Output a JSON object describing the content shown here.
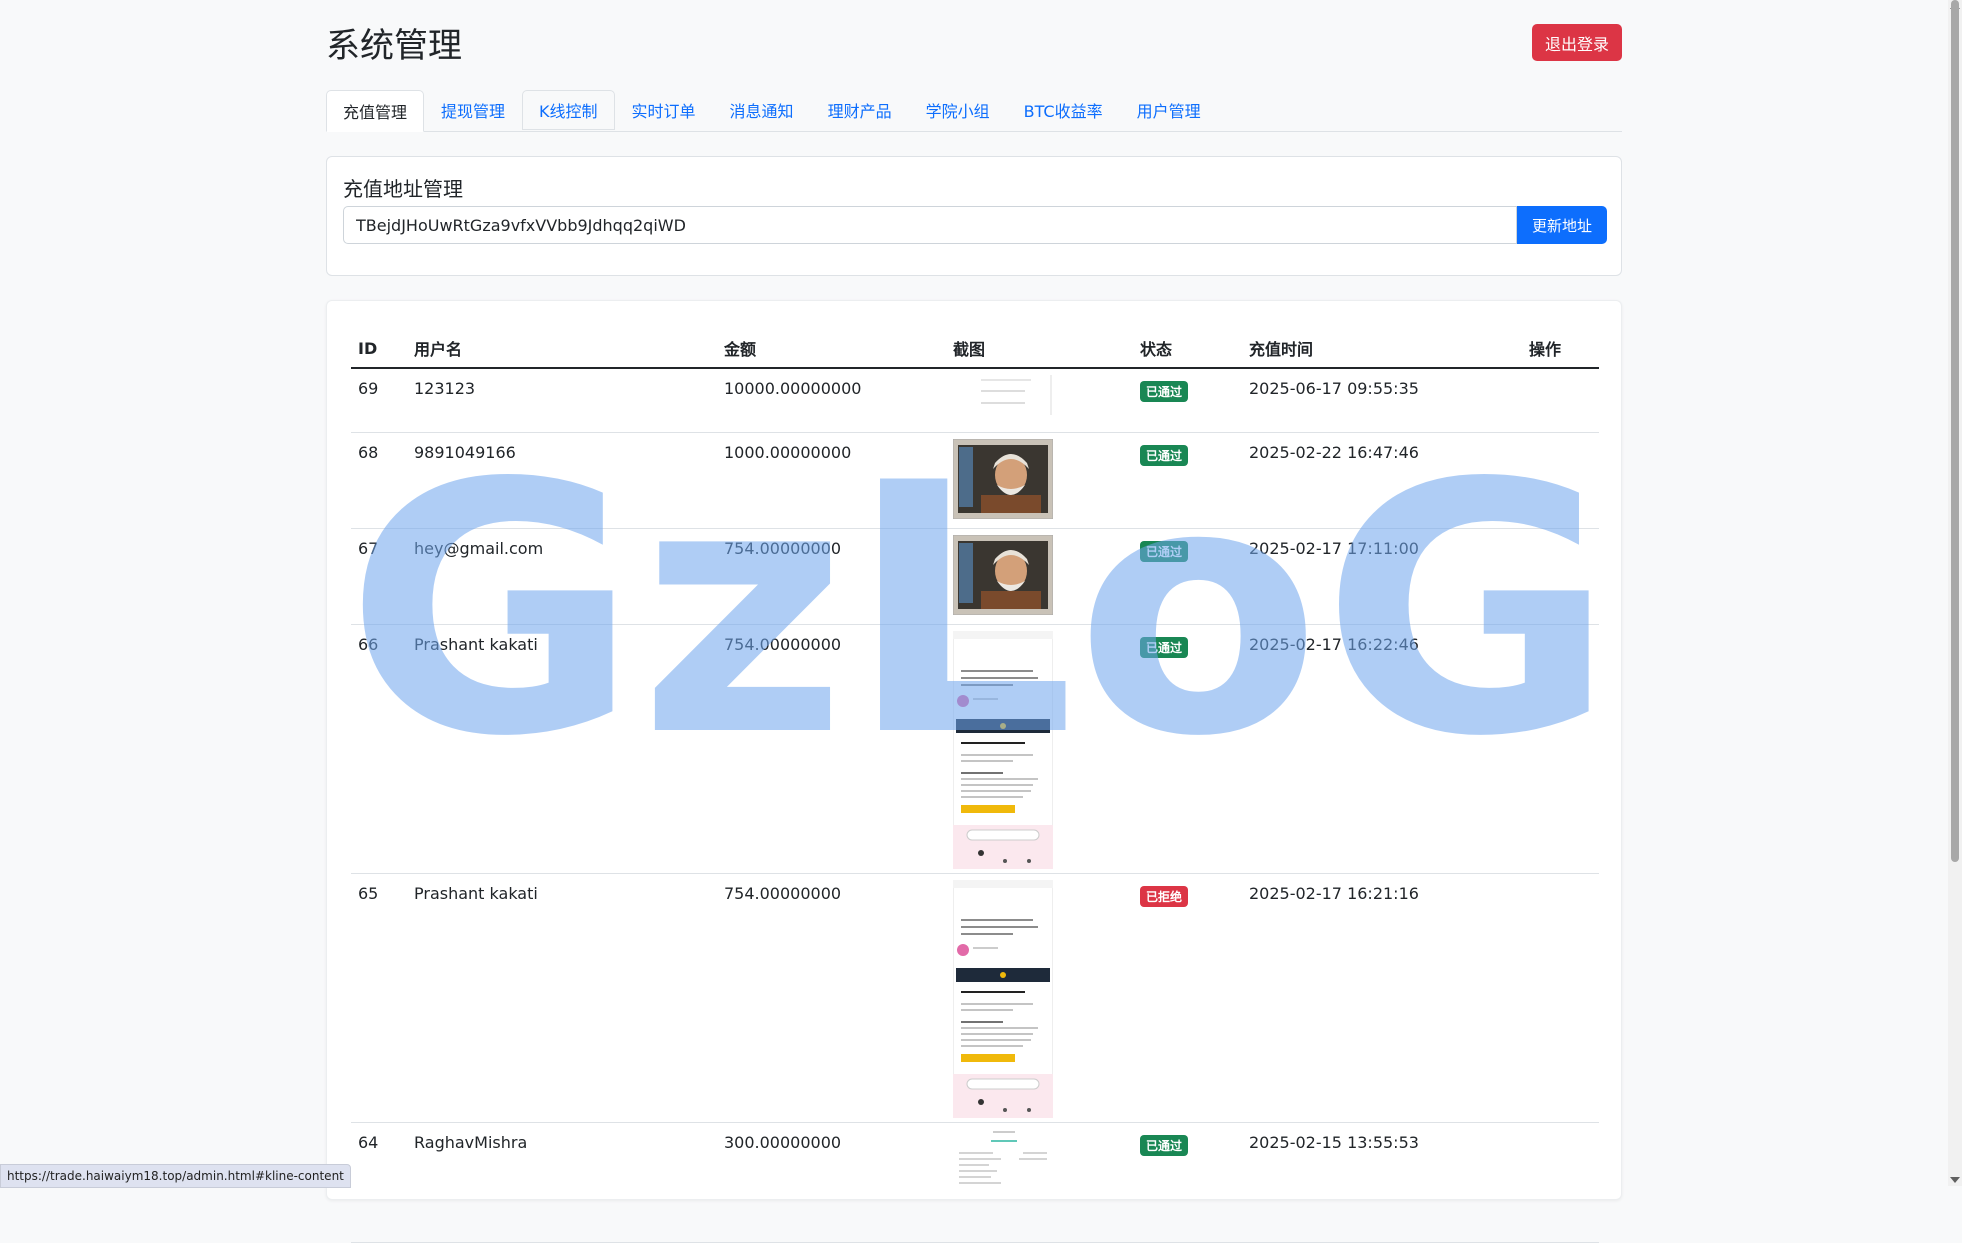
{
  "header": {
    "title": "系统管理",
    "logout_label": "退出登录"
  },
  "tabs": [
    {
      "label": "充值管理",
      "active": true
    },
    {
      "label": "提现管理",
      "active": false
    },
    {
      "label": "K线控制",
      "active": false
    },
    {
      "label": "实时订单",
      "active": false
    },
    {
      "label": "消息通知",
      "active": false
    },
    {
      "label": "理财产品",
      "active": false
    },
    {
      "label": "学院小组",
      "active": false
    },
    {
      "label": "BTC收益率",
      "active": false
    },
    {
      "label": "用户管理",
      "active": false
    }
  ],
  "address_card": {
    "title": "充值地址管理",
    "address_value": "TBejdJHoUwRtGza9vfxVVbb9Jdhqq2qiWD",
    "update_label": "更新地址"
  },
  "table": {
    "headers": [
      "ID",
      "用户名",
      "金额",
      "截图",
      "状态",
      "充值时间",
      "操作"
    ],
    "rows": [
      {
        "id": "69",
        "username": "123123",
        "amount": "10000.00000000",
        "screenshot": "list",
        "status": "已通过",
        "status_type": "success",
        "time": "2025-06-17 09:55:35"
      },
      {
        "id": "68",
        "username": "9891049166",
        "amount": "1000.00000000",
        "screenshot": "portrait",
        "status": "已通过",
        "status_type": "success",
        "time": "2025-02-22 16:47:46"
      },
      {
        "id": "67",
        "username": "hey@gmail.com",
        "amount": "754.00000000",
        "screenshot": "portrait",
        "status": "已通过",
        "status_type": "success",
        "time": "2025-02-17 17:11:00"
      },
      {
        "id": "66",
        "username": "Prashant kakati",
        "amount": "754.00000000",
        "screenshot": "phone",
        "status": "已通过",
        "status_type": "success",
        "time": "2025-02-17 16:22:46"
      },
      {
        "id": "65",
        "username": "Prashant kakati",
        "amount": "754.00000000",
        "screenshot": "phone",
        "status": "已拒绝",
        "status_type": "danger",
        "time": "2025-02-17 16:21:16"
      },
      {
        "id": "64",
        "username": "RaghavMishra",
        "amount": "300.00000000",
        "screenshot": "receipt",
        "status": "已通过",
        "status_type": "success",
        "time": "2025-02-15 13:55:53"
      }
    ]
  },
  "watermark": {
    "text": "GzLoG",
    "color": "#6fa6ee"
  },
  "status_bar": {
    "url": "https://trade.haiwaiym18.top/admin.html#kline-content"
  },
  "colors": {
    "primary": "#0d6efd",
    "danger": "#dc3545",
    "success": "#198754"
  }
}
